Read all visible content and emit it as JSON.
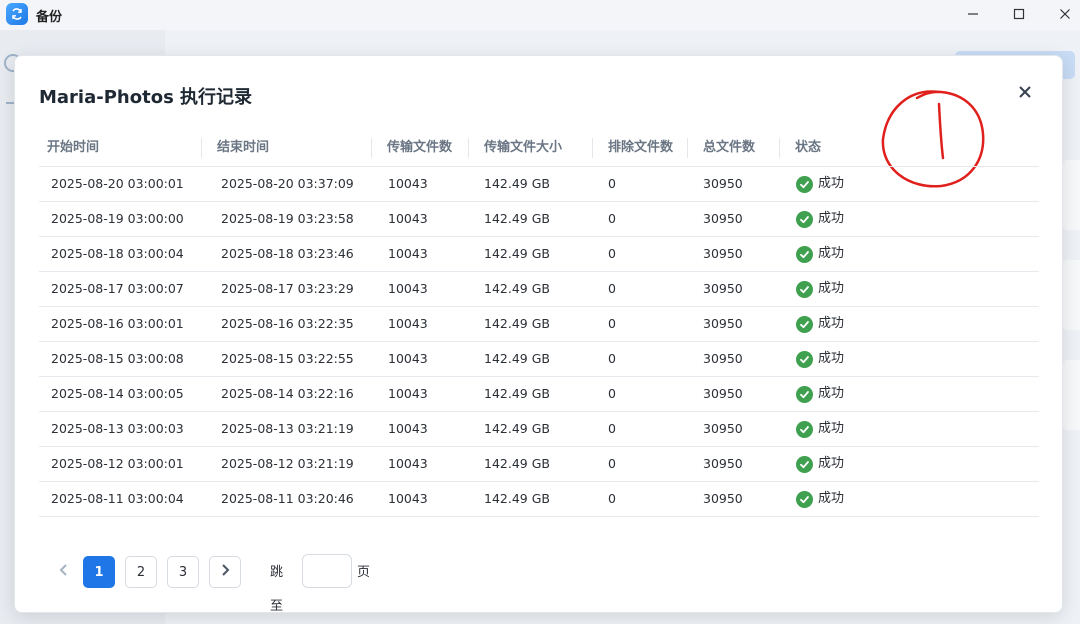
{
  "window": {
    "title": "备份",
    "icons": {
      "app": "sync-icon",
      "minimize": "minimize-icon",
      "maximize": "maximize-icon",
      "close": "close-icon"
    }
  },
  "modal": {
    "title": "Maria-Photos 执行记录",
    "close_icon": "close-icon"
  },
  "table": {
    "columns": [
      "开始时间",
      "结束时间",
      "传输文件数",
      "传输文件大小",
      "排除文件数",
      "总文件数",
      "状态"
    ],
    "rows": [
      {
        "start": "2025-08-20 03:00:01",
        "end": "2025-08-20 03:37:09",
        "files": "10043",
        "size": "142.49 GB",
        "excluded": "0",
        "total": "30950",
        "status": "成功"
      },
      {
        "start": "2025-08-19 03:00:00",
        "end": "2025-08-19 03:23:58",
        "files": "10043",
        "size": "142.49 GB",
        "excluded": "0",
        "total": "30950",
        "status": "成功"
      },
      {
        "start": "2025-08-18 03:00:04",
        "end": "2025-08-18 03:23:46",
        "files": "10043",
        "size": "142.49 GB",
        "excluded": "0",
        "total": "30950",
        "status": "成功"
      },
      {
        "start": "2025-08-17 03:00:07",
        "end": "2025-08-17 03:23:29",
        "files": "10043",
        "size": "142.49 GB",
        "excluded": "0",
        "total": "30950",
        "status": "成功"
      },
      {
        "start": "2025-08-16 03:00:01",
        "end": "2025-08-16 03:22:35",
        "files": "10043",
        "size": "142.49 GB",
        "excluded": "0",
        "total": "30950",
        "status": "成功"
      },
      {
        "start": "2025-08-15 03:00:08",
        "end": "2025-08-15 03:22:55",
        "files": "10043",
        "size": "142.49 GB",
        "excluded": "0",
        "total": "30950",
        "status": "成功"
      },
      {
        "start": "2025-08-14 03:00:05",
        "end": "2025-08-14 03:22:16",
        "files": "10043",
        "size": "142.49 GB",
        "excluded": "0",
        "total": "30950",
        "status": "成功"
      },
      {
        "start": "2025-08-13 03:00:03",
        "end": "2025-08-13 03:21:19",
        "files": "10043",
        "size": "142.49 GB",
        "excluded": "0",
        "total": "30950",
        "status": "成功"
      },
      {
        "start": "2025-08-12 03:00:01",
        "end": "2025-08-12 03:21:19",
        "files": "10043",
        "size": "142.49 GB",
        "excluded": "0",
        "total": "30950",
        "status": "成功"
      },
      {
        "start": "2025-08-11 03:00:04",
        "end": "2025-08-11 03:20:46",
        "files": "10043",
        "size": "142.49 GB",
        "excluded": "0",
        "total": "30950",
        "status": "成功"
      }
    ],
    "status_icon": "check-circle-icon",
    "status_color": "#3fa14f"
  },
  "pagination": {
    "prev_icon": "chevron-left-icon",
    "next_icon": "chevron-right-icon",
    "pages": [
      "1",
      "2",
      "3"
    ],
    "current_page": "1",
    "jump_label": "跳至",
    "jump_suffix": "页",
    "jump_value": "",
    "accent": "#1f76e6"
  },
  "annotation": {
    "kind": "hand-drawn-red-circle-with-mark",
    "color": "#e0201c"
  }
}
